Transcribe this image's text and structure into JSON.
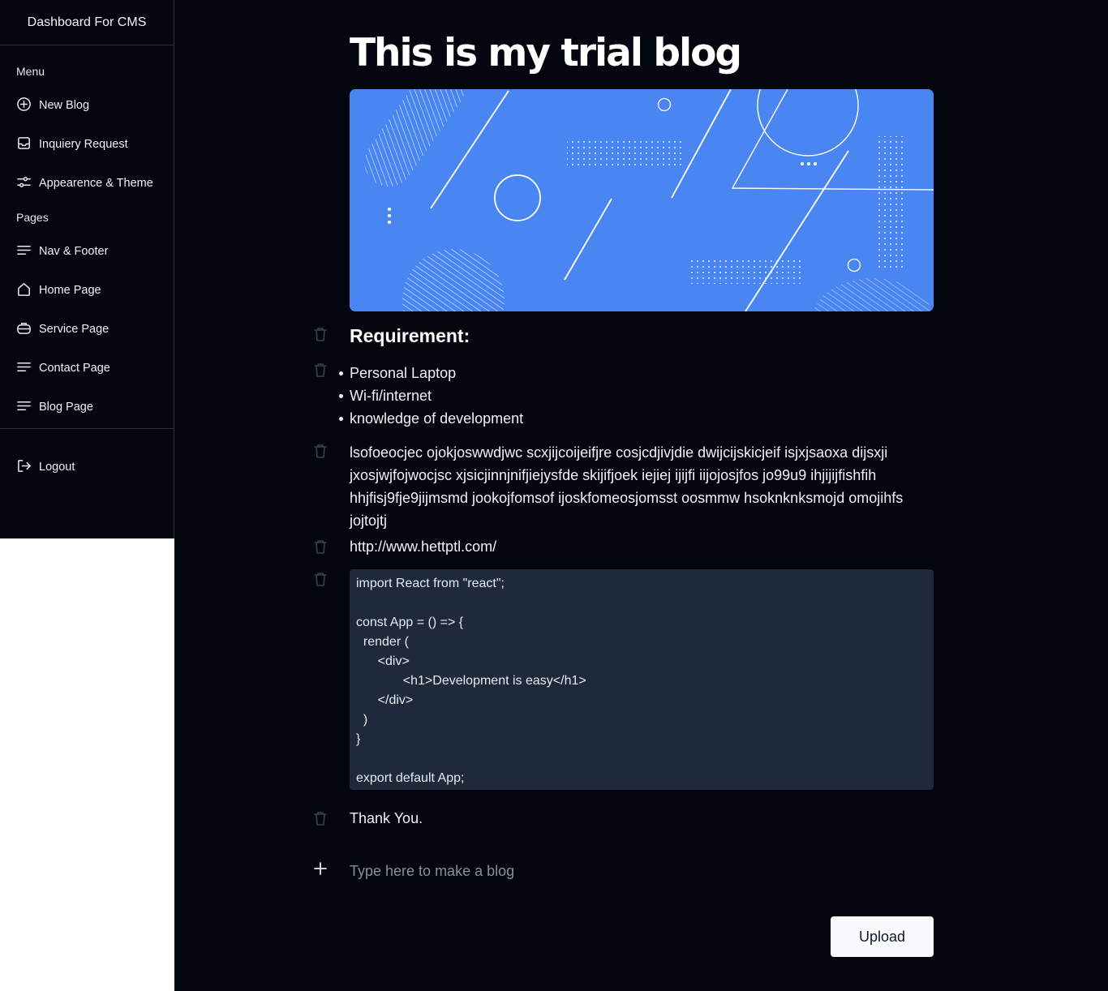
{
  "sidebar": {
    "brand": "Dashboard For CMS",
    "menu_label": "Menu",
    "menu_items": [
      {
        "label": "New Blog",
        "icon": "plus-circle-icon"
      },
      {
        "label": "Inquiery Request",
        "icon": "inbox-icon"
      },
      {
        "label": "Appearence & Theme",
        "icon": "sliders-icon"
      }
    ],
    "pages_label": "Pages",
    "page_items": [
      {
        "label": "Nav & Footer",
        "icon": "menu-lines-icon"
      },
      {
        "label": "Home Page",
        "icon": "home-icon"
      },
      {
        "label": "Service Page",
        "icon": "briefcase-icon"
      },
      {
        "label": "Contact Page",
        "icon": "menu-lines-icon"
      },
      {
        "label": "Blog Page",
        "icon": "menu-lines-icon"
      }
    ],
    "logout": {
      "label": "Logout",
      "icon": "logout-icon"
    }
  },
  "blog": {
    "title": "This is my trial blog",
    "heading": "Requirement:",
    "list": [
      "Personal Laptop",
      "Wi-fi/internet",
      "knowledge of development"
    ],
    "paragraph": "lsofoeocjec ojokjoswwdjwc scxjijcoijeifjre cosjcdjivjdie dwijcijskicjeif isjxjsaoxa dijsxji jxosjwjfojwocjsc xjsicjinnjnifjiejysfde skijifjoek  iejiej ijijfi iijojosjfos jo99u9 ihjijijfishfih hhjfisj9fje9jijmsmd jookojfomsof ijoskfomeosjomsst oosmmw hsoknknksmojd omojihfs jojtojtj",
    "link": "http://www.hettptl.com/",
    "code": "import React from \"react\";\n\nconst App = () => {\n  render (\n      <div>\n             <h1>Development is easy</h1>\n      </div>\n  )\n}\n\nexport default App;",
    "closing": "Thank You."
  },
  "composer": {
    "placeholder": "Type here to make a blog",
    "upload_label": "Upload"
  },
  "colors": {
    "background": "#03060f",
    "banner": "#4a86f2",
    "code_block": "#1e293b",
    "button": "#f8fafc"
  }
}
